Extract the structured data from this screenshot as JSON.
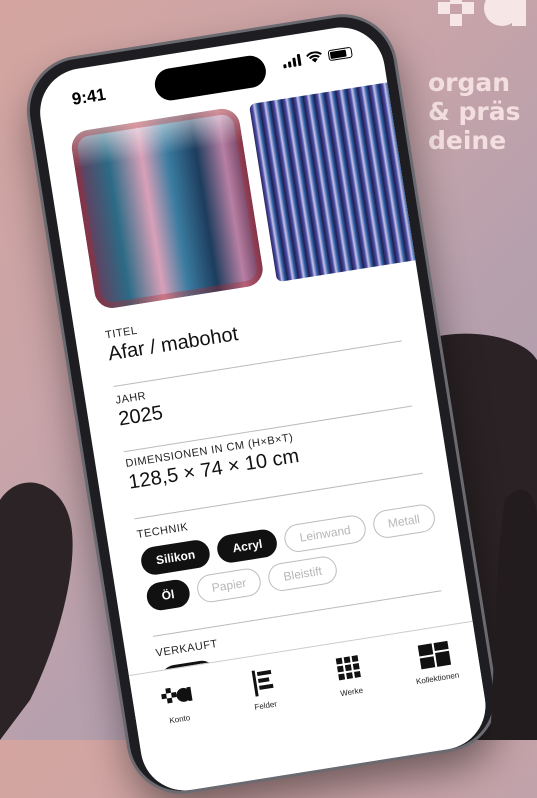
{
  "brand": {
    "icon": "plus-a-logo-icon"
  },
  "tagline": {
    "line1": "organ",
    "line2": "& präs",
    "line3": "deine"
  },
  "status_bar": {
    "time": "9:41"
  },
  "form": {
    "title_label": "TITEL",
    "title_value": "Afar / mabohot",
    "year_label": "JAHR",
    "year_value": "2025",
    "dimensions_label": "DIMENSIONEN IN CM (H×B×T)",
    "dimensions_value": "128,5 × 74 × 10 cm",
    "technique_label": "TECHNIK",
    "techniques": [
      {
        "label": "Silikon",
        "selected": true
      },
      {
        "label": "Acryl",
        "selected": true
      },
      {
        "label": "Leinwand",
        "selected": false
      },
      {
        "label": "Metall",
        "selected": false
      },
      {
        "label": "Bleistift",
        "selected": false
      },
      {
        "label": "Papier",
        "selected": false
      },
      {
        "label": "Öl",
        "selected": true
      }
    ],
    "sold_label": "VERKAUFT",
    "sold": true
  },
  "tabbar": {
    "items": [
      {
        "label": "Konto",
        "icon": "plus-a-logo-icon"
      },
      {
        "label": "Felder",
        "icon": "fields-icon"
      },
      {
        "label": "Werke",
        "icon": "grid-icon"
      },
      {
        "label": "Kollektionen",
        "icon": "collections-icon"
      }
    ]
  },
  "colors": {
    "accent": "#111111",
    "tagline": "#f3dfe0",
    "background": "#c9a4a8"
  }
}
